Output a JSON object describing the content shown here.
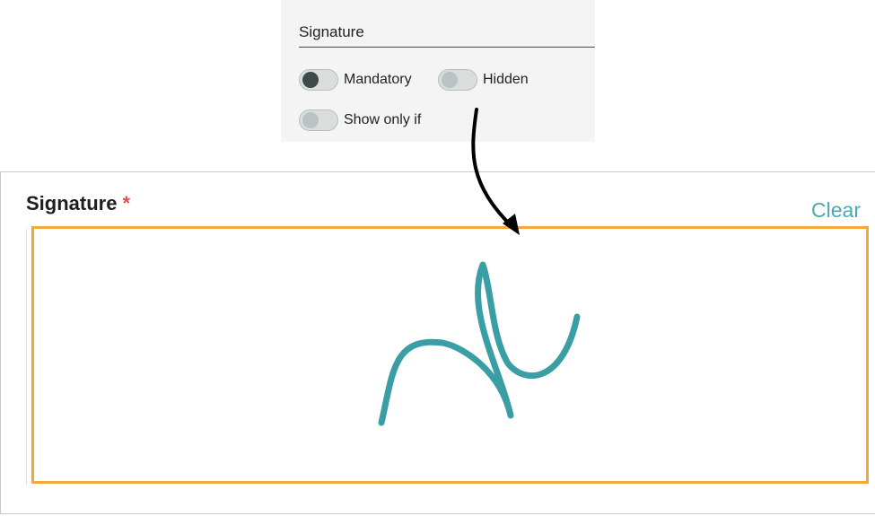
{
  "settings": {
    "field_name": "Signature",
    "toggles": [
      {
        "label": "Mandatory",
        "on": true
      },
      {
        "label": "Hidden",
        "on": false
      },
      {
        "label": "Show only if",
        "on": false
      }
    ]
  },
  "form": {
    "field_label": "Signature",
    "required_marker": "*",
    "clear_label": "Clear"
  },
  "colors": {
    "signature_stroke": "#3a9ea5",
    "pad_border": "#f4a73b",
    "clear_link": "#4aa8b1",
    "required": "#d9534f",
    "arrow": "#000000"
  },
  "icons": {
    "annotation": "curved-arrow-icon"
  }
}
